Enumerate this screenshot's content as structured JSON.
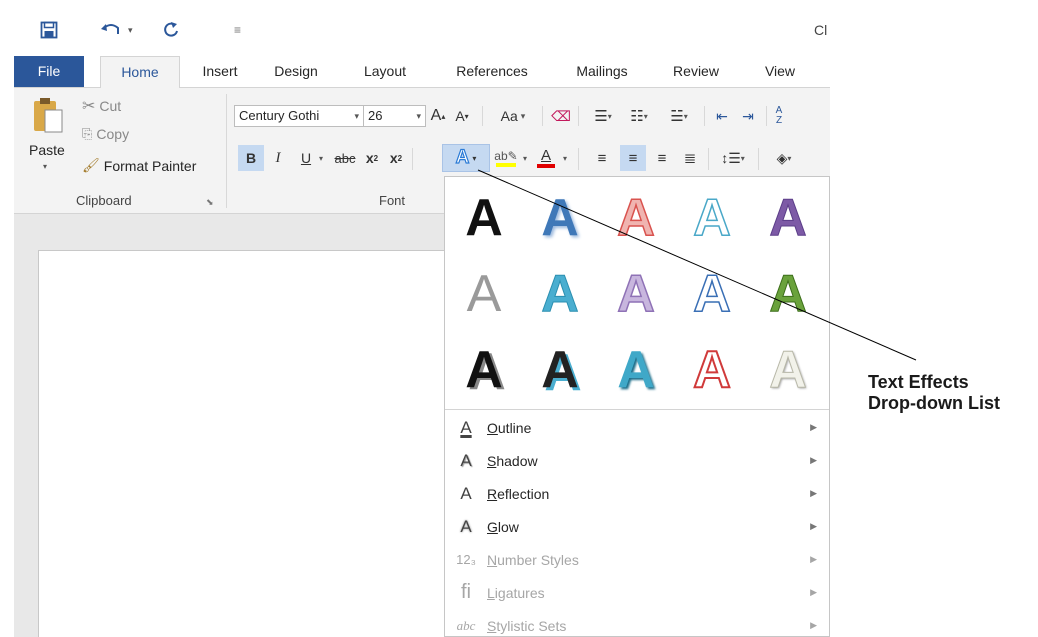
{
  "title_fragment": "Cl",
  "tabs": [
    "File",
    "Home",
    "Insert",
    "Design",
    "Layout",
    "References",
    "Mailings",
    "Review",
    "View"
  ],
  "clipboard": {
    "paste": "Paste",
    "cut": "Cut",
    "copy": "Copy",
    "format_painter": "Format Painter",
    "group_label": "Clipboard"
  },
  "font": {
    "name": "Century Gothi",
    "size": "26",
    "change_case": "Aa",
    "group_label": "Font",
    "bold": "B",
    "italic": "I",
    "underline": "U",
    "strikethrough": "abc",
    "subscript": "x",
    "superscript": "x"
  },
  "text_effects_menu": {
    "items": [
      {
        "label": "Outline",
        "icon": "outline-icon",
        "enabled": true
      },
      {
        "label": "Shadow",
        "icon": "shadow-icon",
        "enabled": true
      },
      {
        "label": "Reflection",
        "icon": "reflection-icon",
        "enabled": true
      },
      {
        "label": "Glow",
        "icon": "glow-icon",
        "enabled": true
      },
      {
        "label": "Number Styles",
        "icon": "number-styles-icon",
        "enabled": false
      },
      {
        "label": "Ligatures",
        "icon": "ligatures-icon",
        "enabled": false
      },
      {
        "label": "Stylistic Sets",
        "icon": "stylistic-sets-icon",
        "enabled": false
      }
    ]
  },
  "callout": {
    "line1": "Text Effects",
    "line2": "Drop-down List"
  },
  "colors": {
    "accent": "#2b579a",
    "highlight": "#ffff00",
    "font_color": "#e00000"
  }
}
